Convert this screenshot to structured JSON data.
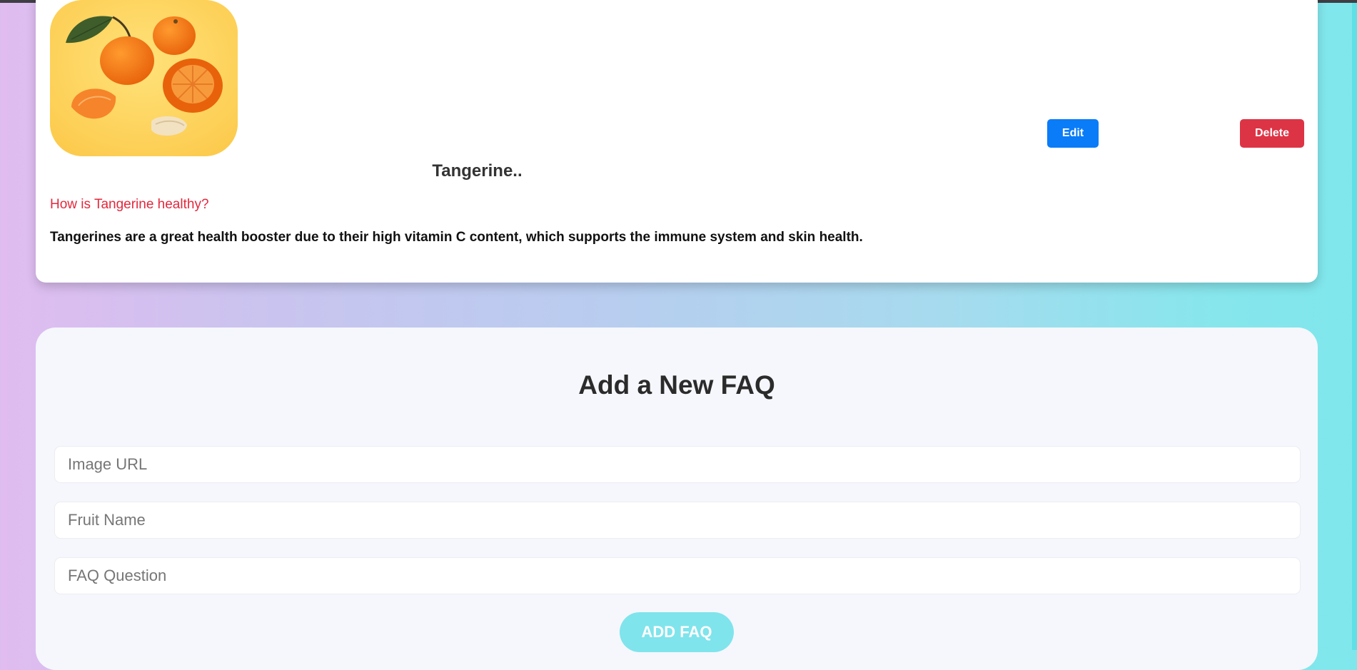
{
  "faq_item": {
    "image_alt": "tangerine-photo",
    "fruit_name": "Tangerine..",
    "question": "How is Tangerine healthy?",
    "answer": "Tangerines are a great health booster due to their high vitamin C content, which supports the immune system and skin health.",
    "edit_label": "Edit",
    "delete_label": "Delete"
  },
  "form": {
    "title": "Add a New FAQ",
    "image_url_placeholder": "Image URL",
    "fruit_name_placeholder": "Fruit Name",
    "faq_question_placeholder": "FAQ Question",
    "submit_label": "ADD FAQ"
  },
  "colors": {
    "edit_button": "#0a7cf8",
    "delete_button": "#dd3445",
    "question_text": "#e3283c",
    "add_button": "#7fe4ec"
  }
}
